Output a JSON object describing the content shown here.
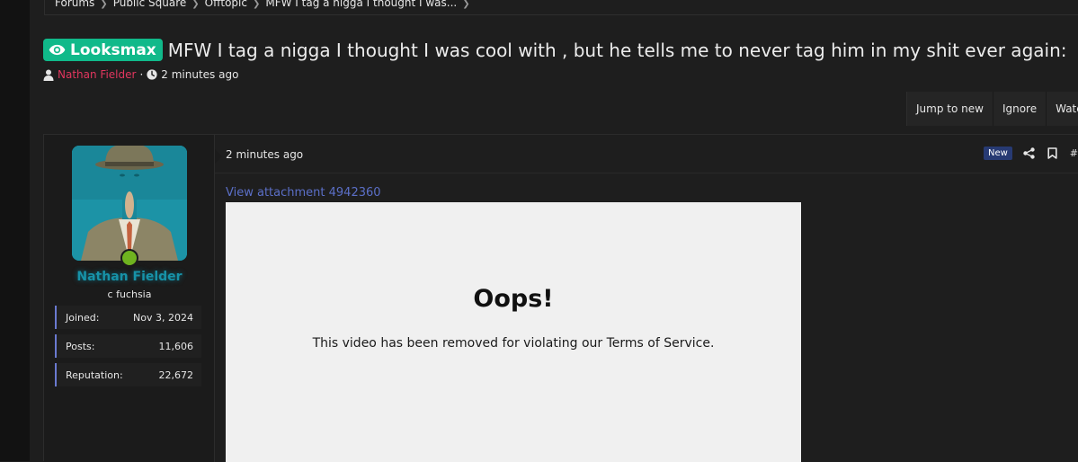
{
  "breadcrumb": {
    "items": [
      "Forums",
      "Public Square",
      "Offtopic",
      "MFW I tag a nigga I thought I was..."
    ]
  },
  "thread": {
    "prefix": "Looksmax",
    "title": "MFW I tag a nigga I thought I was cool with , but he tells me to never tag him in my shit ever again:",
    "author": "Nathan Fielder",
    "meta_separator": "·",
    "time": "2 minutes ago"
  },
  "actions": {
    "jump_to_new": "Jump to new",
    "ignore": "Ignore",
    "watch": "Watch"
  },
  "post": {
    "user": {
      "name": "Nathan Fielder",
      "title": "c fuchsia",
      "stats": [
        {
          "label": "Joined:",
          "value": "Nov 3, 2024"
        },
        {
          "label": "Posts:",
          "value": "11,606"
        },
        {
          "label": "Reputation:",
          "value": "22,672"
        }
      ]
    },
    "date": "2 minutes ago",
    "badge": "New",
    "hash": "#",
    "attachment_link": "View attachment 4942360",
    "video": {
      "heading": "Oops!",
      "message": "This video has been removed for violating our Terms of Service."
    }
  },
  "colors": {
    "prefix_badge": "#10b98a",
    "author_link": "#e2365e",
    "username": "#1792a8",
    "new_badge": "#273a73",
    "stat_border": "#6a7ad0",
    "attachment_link": "#5b6fc7",
    "online_dot": "#6fb31f"
  },
  "icons": {
    "prefix": "eye-icon",
    "author": "user-icon",
    "time": "clock-icon",
    "share": "share-icon",
    "bookmark": "bookmark-icon",
    "breadcrumb_separator": "chevron-right-icon"
  }
}
